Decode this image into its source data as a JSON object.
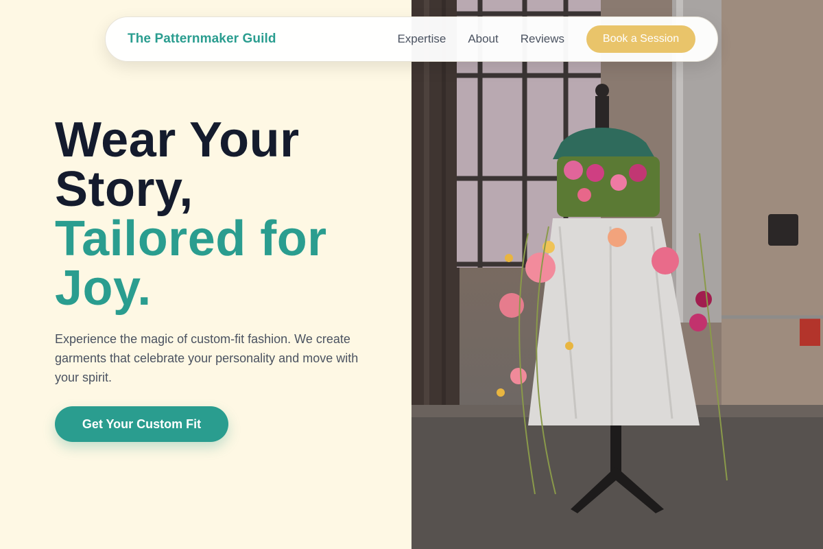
{
  "nav": {
    "brand": "The Patternmaker Guild",
    "links": [
      "Expertise",
      "About",
      "Reviews"
    ],
    "cta": "Book a Session"
  },
  "hero": {
    "title_line1": "Wear Your",
    "title_line2": "Story,",
    "title_line3": "Tailored for",
    "title_line4": "Joy.",
    "description": "Experience the magic of custom-fit fashion. We create garments that celebrate your personality and move with your spirit.",
    "cta": "Get Your Custom Fit"
  },
  "colors": {
    "background": "#fef8e4",
    "accent_teal": "#2a9d8f",
    "accent_gold": "#e9c46a",
    "heading_dark": "#141b2d",
    "body_text": "#4a5260"
  },
  "image": {
    "subject": "floral-dress-mannequin-photo"
  }
}
